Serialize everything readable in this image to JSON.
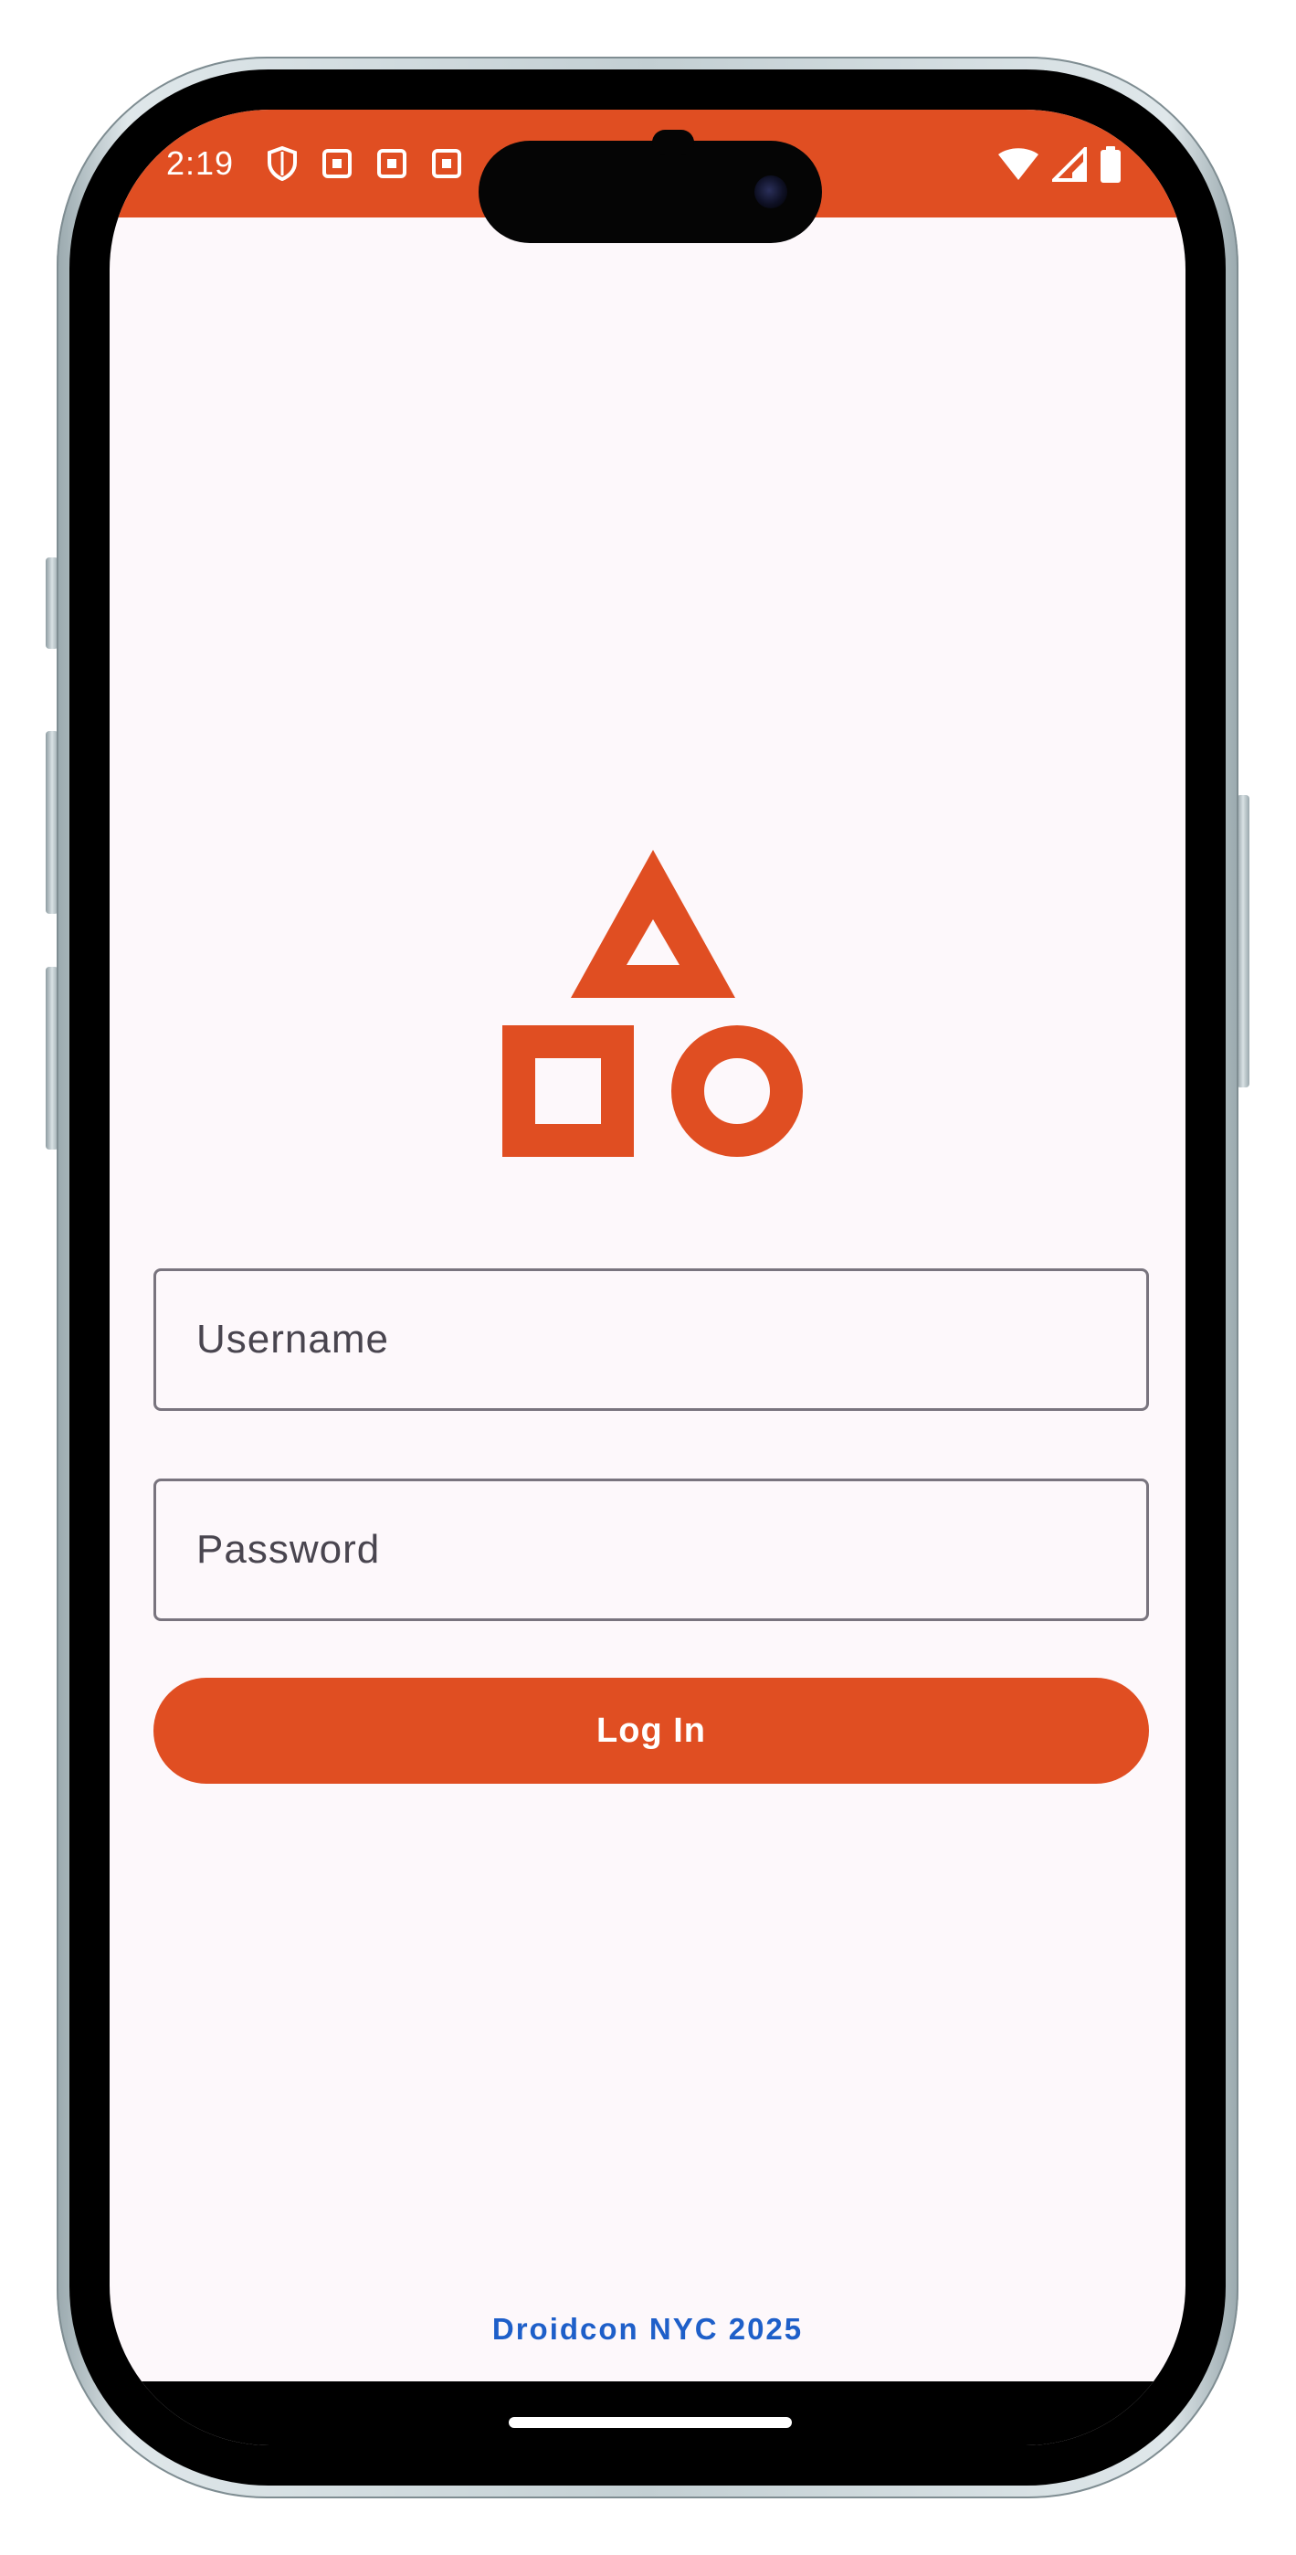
{
  "status_bar": {
    "time": "2:19",
    "background_color": "#e04e22",
    "left_icons": [
      "shield-icon",
      "notification-square-icon",
      "notification-square-icon",
      "notification-square-icon"
    ],
    "right_icons": [
      "wifi-icon",
      "cell-signal-icon",
      "battery-icon"
    ]
  },
  "logo": {
    "icon": "shapes-logo-icon",
    "color": "#e04e22"
  },
  "form": {
    "username_placeholder": "Username",
    "password_placeholder": "Password",
    "login_label": "Log In"
  },
  "footer": {
    "text": "Droidcon NYC 2025",
    "color": "#1e5fc9"
  },
  "colors": {
    "accent": "#e04e22",
    "screen_background": "#fdf8fb",
    "field_border": "#79747e"
  }
}
